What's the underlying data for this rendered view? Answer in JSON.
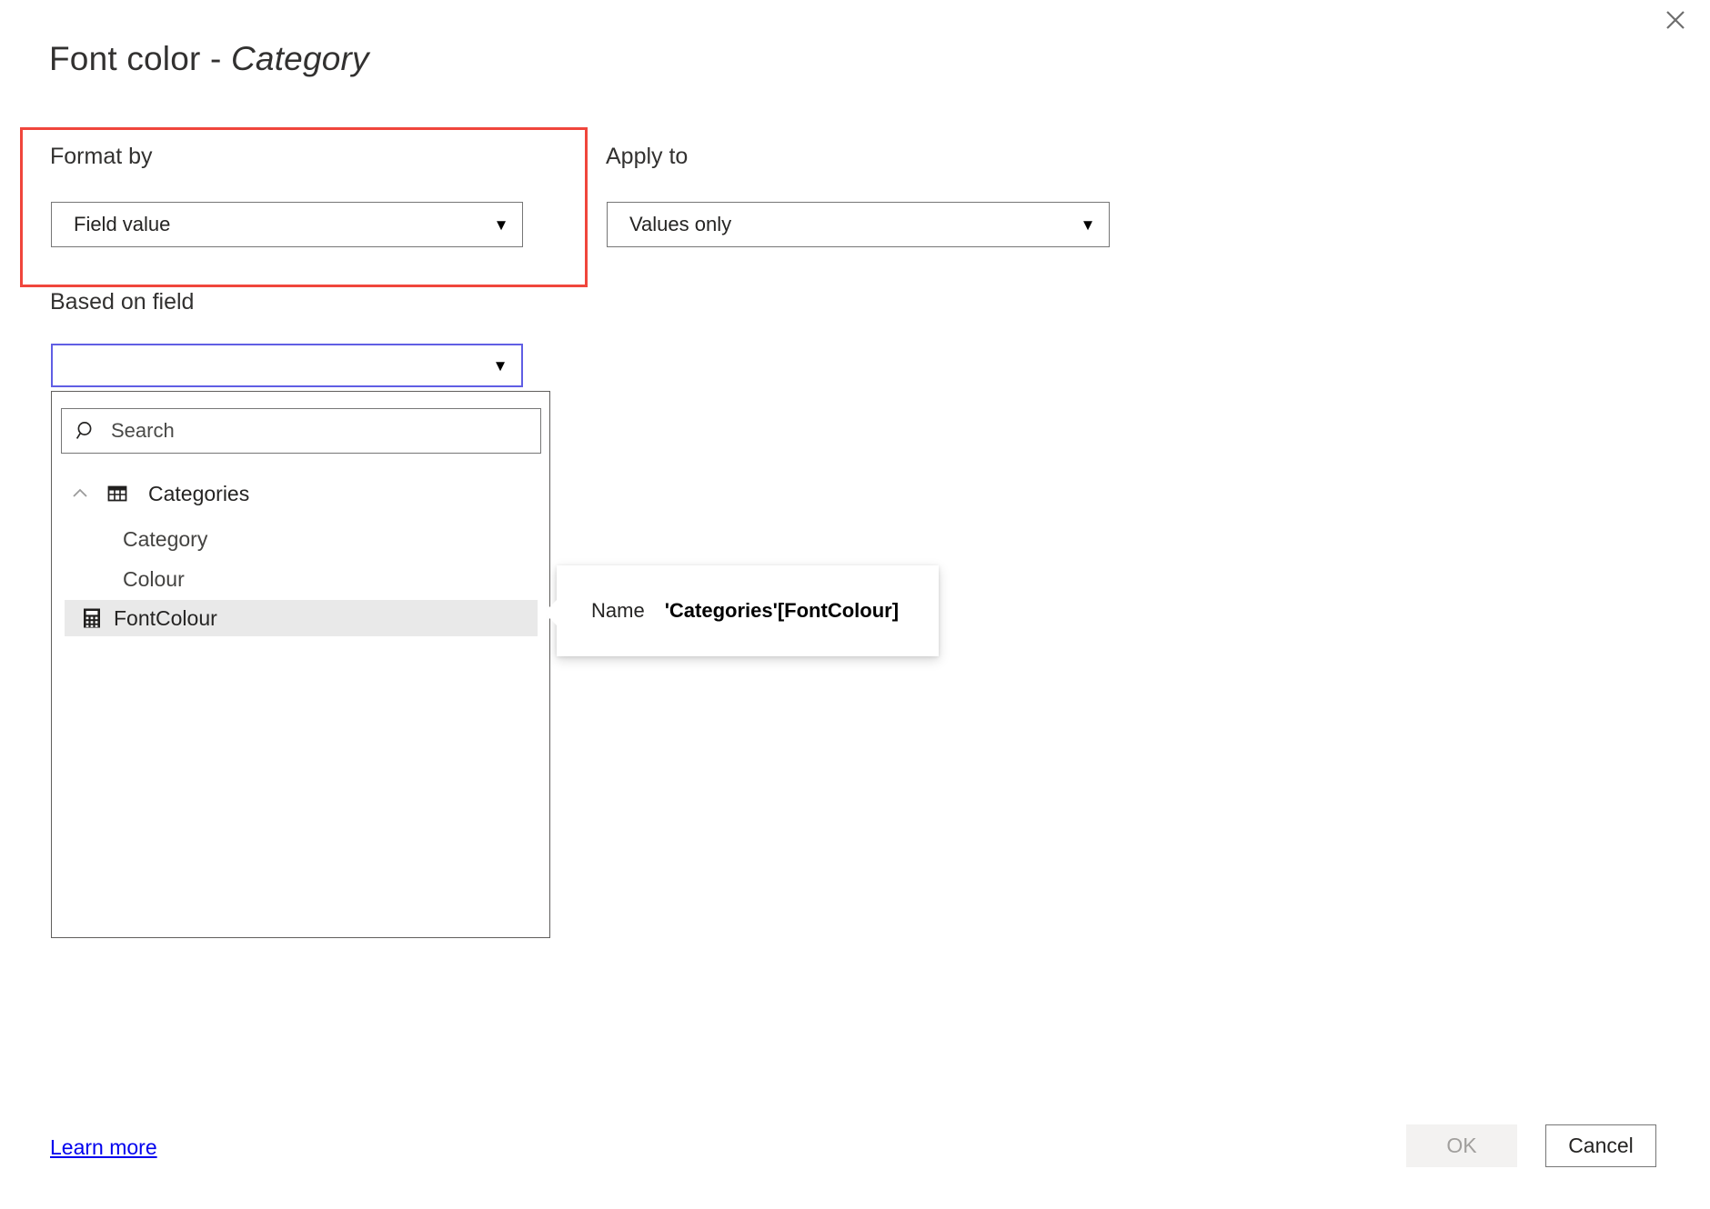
{
  "dialog": {
    "title_prefix": "Font color - ",
    "title_subject": "Category",
    "close_icon": "close-icon"
  },
  "format_by": {
    "label": "Format by",
    "value": "Field value",
    "caret": "▼"
  },
  "apply_to": {
    "label": "Apply to",
    "value": "Values only",
    "caret": "▼"
  },
  "based_on_field": {
    "label": "Based on field",
    "value": "",
    "caret": "▼"
  },
  "field_dropdown": {
    "search_placeholder": "Search",
    "search_icon": "search-icon",
    "group": {
      "name": "Categories",
      "chevron_icon": "chevron-up-icon",
      "table_icon": "table-icon",
      "expanded": true
    },
    "fields": [
      {
        "name": "Category",
        "icon": "",
        "selected": false
      },
      {
        "name": "Colour",
        "icon": "",
        "selected": false
      },
      {
        "name": "FontColour",
        "icon": "measure-icon",
        "selected": true
      }
    ]
  },
  "tooltip": {
    "key": "Name",
    "value": "'Categories'[FontColour]"
  },
  "footer": {
    "learn_more": "Learn more",
    "ok_label": "OK",
    "cancel_label": "Cancel"
  },
  "colors": {
    "highlight": "#f0463c",
    "focus_border": "#605ee4",
    "link": "#0000ee",
    "selected_row_bg": "#e9e9e9"
  }
}
